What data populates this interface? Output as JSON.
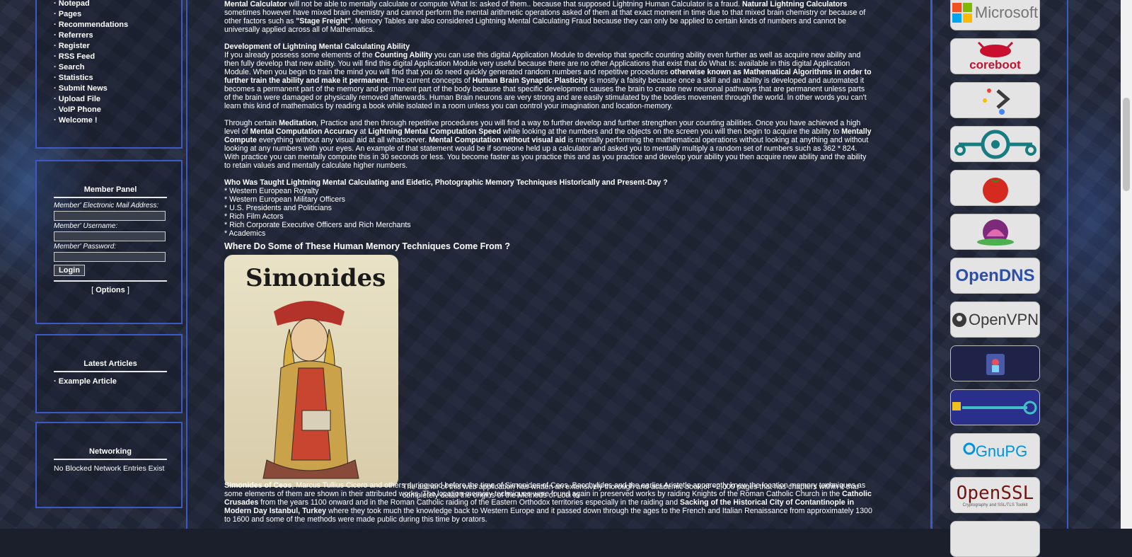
{
  "left_menu": {
    "items": [
      "Notepad",
      "Pages",
      "Recommendations",
      "Referrers",
      "Register",
      "RSS Feed",
      "Search",
      "Statistics",
      "Submit News",
      "Upload File",
      "VoIP Phone",
      "Welcome !"
    ]
  },
  "member_panel": {
    "title": "Member Panel",
    "email_label": "Member' Electronic Mail Address:",
    "username_label": "Member' Username:",
    "password_label": "Member' Password:",
    "login_label": "Login",
    "options_label": "Options"
  },
  "latest_articles": {
    "title": "Latest Articles",
    "items": [
      "Example Article"
    ]
  },
  "networking": {
    "title": "Networking",
    "text": "No Blocked Network Entries Exist"
  },
  "article": {
    "p1_b1": "Mental Calculator",
    "p1_t1": " will not be able to mentally calculate or compute What Is: asked of them.. because that supposed Lightning Human Calculator is a fraud. ",
    "p1_b2": "Natural Lightning Calculators",
    "p1_t2": " sometimes however have mixed brain chemistry and cannot perform the mental arithmetic operations asked of them at that exact moment in time due to that mixed brain chemistry or because of other factors such as ",
    "p1_b3": "\"Stage Freight\"",
    "p1_t3": ". Memory Tables are also considered Lightning Mental Calculating Fraud because they can only be applied to certain kinds of numbers and cannot be universally applied across all of Mathematics.",
    "h_dev": "Development of Lightning Mental Calculating Ability",
    "p2_t1": "If you already possess some elements of the ",
    "p2_b1": "Counting Ability",
    "p2_t2": " you can use this digital Application Module to develop that specific counting ability even further as well as acquire new ability and then fully develop that new ability. You will find this digital Application Module very useful because there are no other Applications that exist that do What Is: available in this digital Application Module. When you begin to train the mind you will find that you do need quickly generated random numbers and repetitive procedures ",
    "p2_b2": "otherwise known as Mathematical Algorithms in order to further train the ability and make it permanent",
    "p2_t3": ". The current concepts of ",
    "p2_b3": "Human Brain Synaptic Plasticity",
    "p2_t4": " is mostly a falsity because once a skill and an ability is developed and automated it becomes a permanent part of the memory and permanent part of the body because that specific development causes the brain to create new neuronal pathways that are permanent unless parts of the brain were damaged or physically removed afterwards. Human Brain neurons are very strong and are easily stimulated by the bodies movement through the world. In other words you can't learn this kind of mathematics by reading a book while isolated in a room unless you can control your imagination and location-memory.",
    "p3_t1": "Through certain ",
    "p3_b1": "Meditation",
    "p3_t2": ", Practice and then through repetitive procedures you will find a way to further develop and further strengthen your counting abilities. Once you have achieved a high level of ",
    "p3_b2": "Mental Computation Accuracy",
    "p3_t3": " at ",
    "p3_b3": "Lightning Mental Computation Speed",
    "p3_t4": " while looking at the numbers and the objects on the screen you will then begin to acquire the ability to ",
    "p3_b4": "Mentally Compute",
    "p3_t5": " everything without any visual aid at all whatsoever. ",
    "p3_b5": "Mental Computation without visual aid",
    "p3_t6": " is mentally performing the mathematical operations without looking at anything and without looking at any numbers with your eyes. An example of that statement would be if someone held up a calculator and asked you to mentally multiply a random set of numbers such as 362 * 824. With practice you can mentally compute this in 30 seconds or less. You become faster as you practice this and as you practice and develop your ability you then acquire new ability and the ability to retain values and mentally calculate higher numbers.",
    "h_who": "Who Was Taught Lightning Mental Calculating and Eidetic, Photographic Memory Techniques Historically and Present-Day ?",
    "who_list": [
      "* Western European Royalty",
      "* Western European Military Officers",
      "* U.S. Presidents and Politicians",
      "* Rich Film Actors",
      "* Rich Corporate Executive Officers and Rich Merchants",
      "* Academics"
    ],
    "h_where": "Where Do Some of These Human Memory Techniques Come From ?",
    "portrait_caption": "Simonides",
    "p4_t1": " The author of this web application has written an extensively thorough and academic book of ~2,000 pages that has chapters within it that completely detail the origins of the Methods of Loci to ",
    "p4_b1": "Simonides of Ceos",
    "p4_t2": ", Marcus Tullius Cicero and others during and before the time of Simonides of Ceos. Bacchylides and the earlier Aristotle apparently knew the location memory techniques as some elements of them are shown in their attributed works. The location memory techniques were found again in preserved works by raiding Knights of the Roman Catholic Church in the ",
    "p4_b2": "Catholic Crusades",
    "p4_t3": " from the years 1100 onward and in the Roman Catholic raiding of the Eastern Orthodox territories especially in the raiding and ",
    "p4_b3": "Sacking of the Historical City of Contantinople in Modern Day Istanbul, Turkey",
    "p4_t4": " where they took much the knowledge back to Western Europe and it passed down through the ages to the French and Italian Renaissance from approximately 1300 to 1600 and some of the methods were made public during this time by orators."
  },
  "sponsors": {
    "logos": [
      {
        "icon": "microsoft-logo",
        "text": "Microsoft",
        "color": "#737373"
      },
      {
        "icon": "coreboot-logo",
        "text": "coreboot",
        "color": "#c8102e"
      },
      {
        "icon": "prompt-logo",
        "text": "",
        "color": "#333333"
      },
      {
        "icon": "lineageos-logo",
        "text": "",
        "color": "#167c80"
      },
      {
        "icon": "tomato-logo",
        "text": "",
        "color": "#d42a1f"
      },
      {
        "icon": "lotus-logo",
        "text": "",
        "color": "#9b2f8a"
      },
      {
        "icon": "opendns-logo",
        "text": "OpenDNS",
        "color": "#2c4fa8"
      },
      {
        "icon": "openvpn-logo",
        "text": "OpenVPN",
        "color": "#3a3a3a"
      },
      {
        "icon": "security-logo",
        "text": "",
        "color": "#1f2347"
      },
      {
        "icon": "keys-logo",
        "text": "",
        "color": "#2b2f8c"
      },
      {
        "icon": "gnupg-logo",
        "text": "GnuPG",
        "color": "#0093dd"
      },
      {
        "icon": "openssl-logo",
        "text": "OpenSSL",
        "color": "#721412"
      }
    ],
    "openssl_sub": "Cryptography and SSL/TLS Toolkit"
  }
}
